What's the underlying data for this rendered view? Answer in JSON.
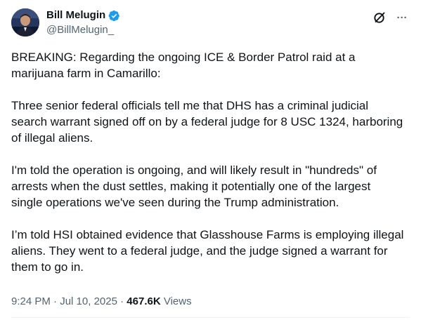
{
  "author": {
    "display_name": "Bill Melugin",
    "handle": "@BillMelugin_",
    "verified": true,
    "avatar_icon": "profile-photo",
    "badge_color": "#1d9bf0"
  },
  "actions": {
    "grok_icon": "grok-icon",
    "more_icon": "more-icon",
    "more_label": "···"
  },
  "tweet": {
    "paragraphs": [
      "BREAKING: Regarding the ongoing ICE & Border Patrol raid at a marijuana farm in Camarillo:",
      "Three senior federal officials tell me that DHS has a criminal judicial search warrant signed off on by a federal judge for 8 USC 1324, harboring of illegal aliens.",
      "I'm told the operation is ongoing, and will likely result in \"hundreds\" of arrests when the dust settles, making it potentially one of the largest single operations we've seen during the Trump administration.",
      "I’m told HSI obtained evidence that Glasshouse Farms is employing illegal aliens. They went to a federal judge, and the judge signed a warrant for them to go in."
    ]
  },
  "meta": {
    "time": "9:24 PM",
    "separator": " · ",
    "date": "Jul 10, 2025",
    "views_count": "467.6K",
    "views_label": " Views"
  },
  "colors": {
    "text_primary": "#0f1419",
    "text_secondary": "#536471",
    "accent": "#1d9bf0"
  }
}
